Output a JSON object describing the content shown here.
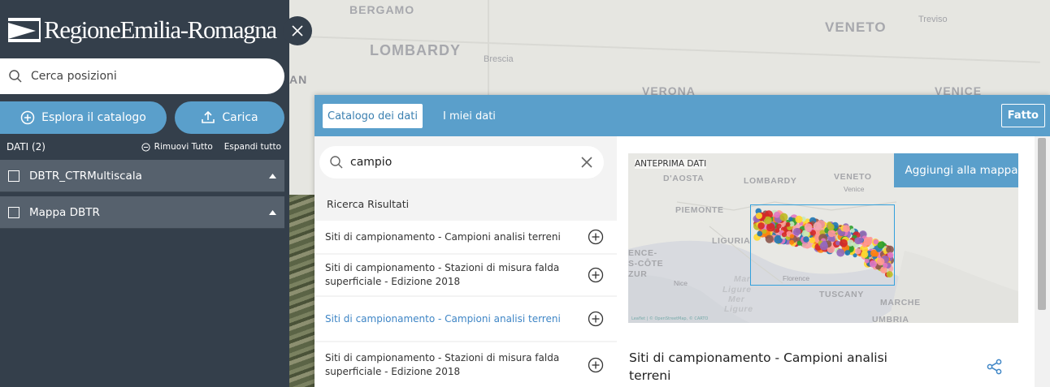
{
  "app": {
    "logo_text": "RegioneEmilia-Romagna"
  },
  "base_map": {
    "regions": [
      "BERGAMO",
      "LOMBARDY",
      "VENETO",
      "VERONA",
      "VENICE"
    ],
    "cities": [
      "Brescia",
      "Treviso"
    ],
    "edge_label": "AN"
  },
  "sidebar": {
    "search_placeholder": "Cerca posizioni",
    "explore_label": "Esplora il catalogo",
    "upload_label": "Carica",
    "data_count": "DATI (2)",
    "remove_all": "Rimuovi Tutto",
    "expand_all": "Espandi tutto",
    "layers": [
      {
        "name": "DBTR_CTRMultiscala"
      },
      {
        "name": "Mappa DBTR"
      }
    ]
  },
  "catalog": {
    "tabs": [
      {
        "label": "Catalogo dei dati",
        "active": true
      },
      {
        "label": "I miei dati",
        "active": false
      }
    ],
    "done_label": "Fatto",
    "search_value": "campio",
    "results_title": "Ricerca Risultati",
    "results": [
      {
        "title": "Siti di campionamento - Campioni analisi terreni",
        "selected": false
      },
      {
        "title": "Siti di campionamento - Stazioni di misura falda superficiale - Edizione 2018",
        "selected": false
      },
      {
        "title": "Siti di campionamento - Campioni analisi terreni",
        "selected": true
      },
      {
        "title": "Siti di campionamento - Stazioni di misura falda superficiale - Edizione 2018",
        "selected": false
      }
    ],
    "preview": {
      "tag": "ANTEPRIMA DATI",
      "add_to_map": "Aggiungi alla mappa",
      "attribution": "Leaflet | © OpenStreetMap, © CARTO",
      "labels": [
        "D'AOSTA",
        "LOMBARDY",
        "VENETO",
        "PIEMONTE",
        "LIGURIA",
        "TUSCANY",
        "MARCHE",
        "Venice",
        "Florence",
        "Nice",
        "Ligure",
        "Mar",
        "Mer",
        "Ligure",
        "ENCE-",
        "S-CÔTE",
        "ZUR",
        "UMBRIA"
      ],
      "title": "Siti di campionamento - Campioni analisi terreni"
    }
  },
  "colors": {
    "sidebar_bg": "#343f4b",
    "accent": "#5a9fcb",
    "layer_bg": "#56616d",
    "selected_link": "#3f86c6"
  }
}
